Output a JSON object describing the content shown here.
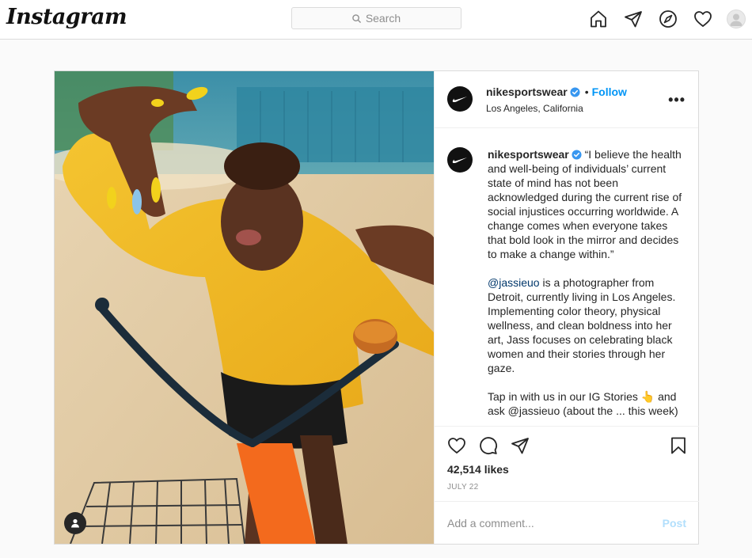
{
  "topbar": {
    "logo": "Instagram",
    "search_placeholder": "Search",
    "icons": [
      "home-icon",
      "direct-icon",
      "explore-icon",
      "activity-icon",
      "profile-avatar"
    ]
  },
  "post": {
    "username": "nikesportswear",
    "follow_label": "Follow",
    "location": "Los Angeles, California",
    "more_label": "•••",
    "caption_user": "nikesportswear",
    "caption_p1": "“I believe the health and well-being of individuals’ current state of mind has not been acknowledged during the current rise of social injustices occurring worldwide. A change comes when everyone takes that bold look in the mirror and decides to make a change within.”",
    "caption_mention": "@jassieuo",
    "caption_p2": " is a photographer from Detroit, currently living in Los Angeles. Implementing color theory, physical wellness, and clean boldness into her art, Jass focuses on celebrating black women and their stories through her gaze.",
    "caption_p3": "Tap in with us in our IG Stories 👆 and",
    "caption_p4": "ask @jassieuo (about the ... this week)",
    "likes": "42,514 likes",
    "date": "JULY 22",
    "comment_placeholder": "Add a comment...",
    "post_label": "Post"
  },
  "colors": {
    "accent": "#0095f6",
    "post_disabled": "#b2dffc",
    "verified": "#3897f0"
  }
}
